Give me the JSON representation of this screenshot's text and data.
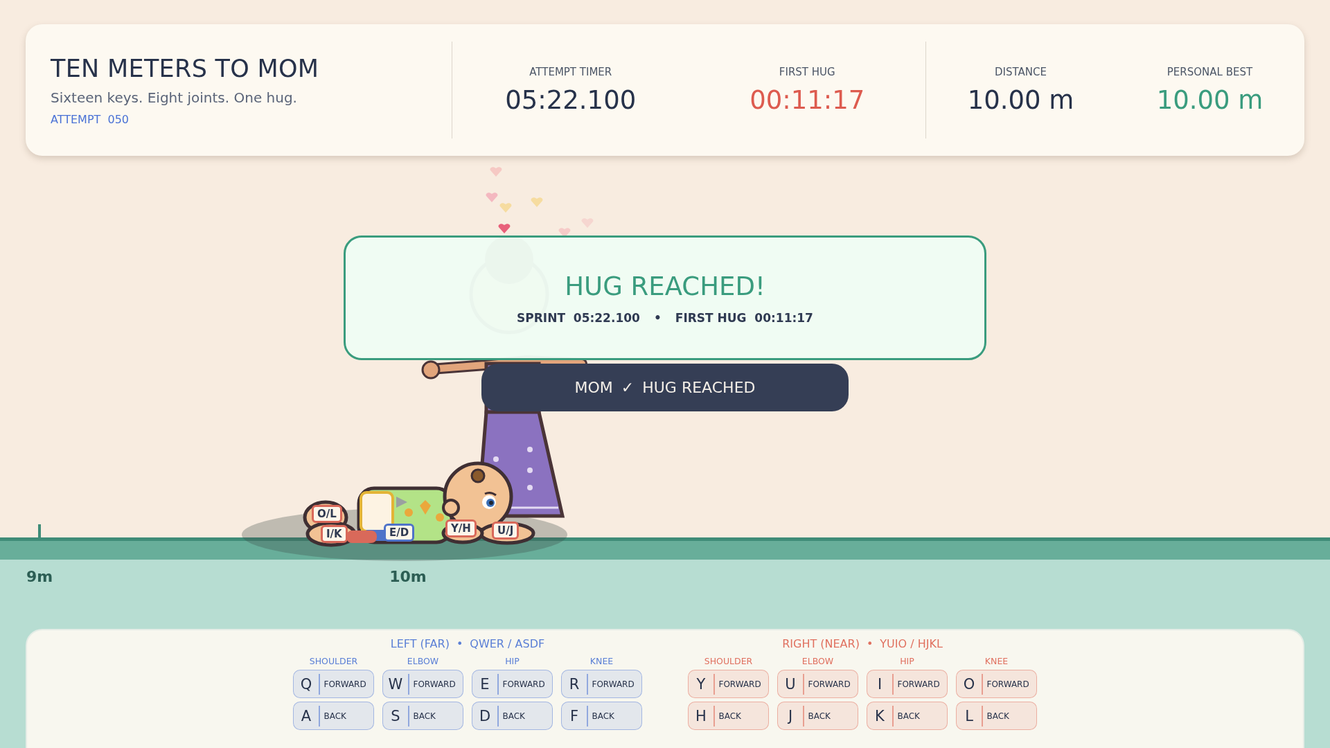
{
  "header": {
    "title": "TEN METERS TO MOM",
    "subtitle": "Sixteen keys. Eight joints. One hug.",
    "attempt_label": "ATTEMPT",
    "attempt_number": "050"
  },
  "stat_groups": [
    {
      "stats": [
        {
          "label": "ATTEMPT TIMER",
          "value": "05:22.100",
          "color": "#27324a"
        },
        {
          "label": "FIRST HUG",
          "value": "00:11:17",
          "color": "#dd5b4f"
        }
      ]
    },
    {
      "stats": [
        {
          "label": "DISTANCE",
          "value": "10.00 m",
          "color": "#27324a"
        },
        {
          "label": "PERSONAL BEST",
          "value": "10.00 m",
          "color": "#3a9c7e"
        }
      ]
    }
  ],
  "result_overlay": {
    "title": "HUG REACHED!",
    "sprint_label": "SPRINT",
    "sprint_value": "05:22.100",
    "separator": "•",
    "first_hug_label": "FIRST HUG",
    "first_hug_value": "00:11:17"
  },
  "status_pill": {
    "name": "MOM",
    "check": "✓",
    "text": "HUG REACHED"
  },
  "limb_tags": [
    {
      "label": "O/L",
      "color": "#d9695a"
    },
    {
      "label": "I/K",
      "color": "#d9695a"
    },
    {
      "label": "E/D",
      "color": "#4f73c9"
    },
    {
      "label": "Y/H",
      "color": "#d9695a"
    },
    {
      "label": "U/J",
      "color": "#d9695a"
    }
  ],
  "track_markers": [
    {
      "label": "9m"
    },
    {
      "label": "10m"
    }
  ],
  "control_groups": [
    {
      "title": "LEFT (FAR)",
      "separator": "•",
      "keys_label": "QWER / ASDF",
      "color": "#5a7fd6",
      "joints": [
        {
          "name": "SHOULDER",
          "forward": {
            "key": "Q",
            "action": "FORWARD"
          },
          "back": {
            "key": "A",
            "action": "BACK"
          }
        },
        {
          "name": "ELBOW",
          "forward": {
            "key": "W",
            "action": "FORWARD"
          },
          "back": {
            "key": "S",
            "action": "BACK"
          }
        },
        {
          "name": "HIP",
          "forward": {
            "key": "E",
            "action": "FORWARD"
          },
          "back": {
            "key": "D",
            "action": "BACK"
          }
        },
        {
          "name": "KNEE",
          "forward": {
            "key": "R",
            "action": "FORWARD"
          },
          "back": {
            "key": "F",
            "action": "BACK"
          }
        }
      ]
    },
    {
      "title": "RIGHT (NEAR)",
      "separator": "•",
      "keys_label": "YUIO / HJKL",
      "color": "#e0705f",
      "joints": [
        {
          "name": "SHOULDER",
          "forward": {
            "key": "Y",
            "action": "FORWARD"
          },
          "back": {
            "key": "H",
            "action": "BACK"
          }
        },
        {
          "name": "ELBOW",
          "forward": {
            "key": "U",
            "action": "FORWARD"
          },
          "back": {
            "key": "J",
            "action": "BACK"
          }
        },
        {
          "name": "HIP",
          "forward": {
            "key": "I",
            "action": "FORWARD"
          },
          "back": {
            "key": "K",
            "action": "BACK"
          }
        },
        {
          "name": "KNEE",
          "forward": {
            "key": "O",
            "action": "FORWARD"
          },
          "back": {
            "key": "L",
            "action": "BACK"
          }
        }
      ]
    }
  ]
}
